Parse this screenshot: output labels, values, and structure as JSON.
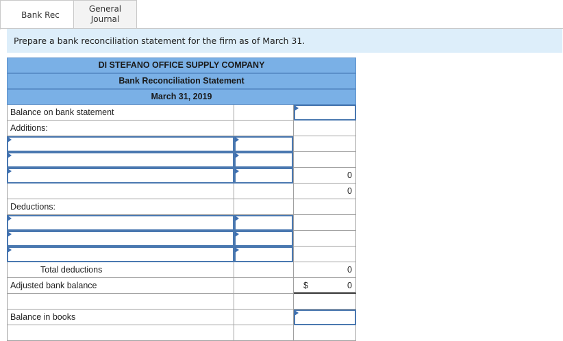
{
  "tabs": [
    {
      "label": "Bank Rec",
      "active": true
    },
    {
      "label": "General\nJournal",
      "active": false
    }
  ],
  "instruction": "Prepare a bank reconciliation statement for the firm as of March 31.",
  "statement": {
    "company": "DI STEFANO OFFICE SUPPLY COMPANY",
    "title": "Bank Reconciliation Statement",
    "date": "March 31, 2019",
    "balance_bank_label": "Balance on bank statement",
    "additions_label": "Additions:",
    "additions_total_col3": "0",
    "additions_subtotal": "0",
    "deductions_label": "Deductions:",
    "total_deductions_label": "Total deductions",
    "total_deductions_value": "0",
    "adjusted_bank_label": "Adjusted bank balance",
    "adjusted_bank_currency": "$",
    "adjusted_bank_value": "0",
    "balance_books_label": "Balance in books"
  },
  "colors": {
    "header_bg": "#7ab0e6",
    "banner_bg": "#ddeefa",
    "input_border": "#4a78b0"
  }
}
